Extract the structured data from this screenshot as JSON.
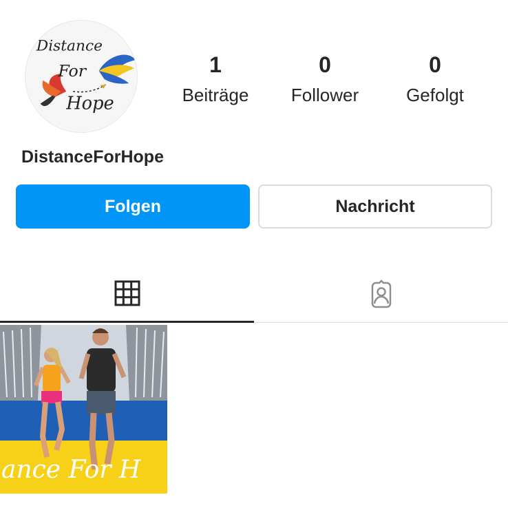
{
  "profile": {
    "username": "DistanceForHope",
    "avatar_alt": "DistanceForHope logo",
    "logo_text": "Distance For Hope",
    "stats": [
      {
        "value": "1",
        "label": "Beiträge"
      },
      {
        "value": "0",
        "label": "Follower"
      },
      {
        "value": "0",
        "label": "Gefolgt"
      }
    ]
  },
  "actions": {
    "follow_label": "Folgen",
    "message_label": "Nachricht"
  },
  "tabs": [
    {
      "name": "posts-grid",
      "icon": "grid-icon",
      "active": true
    },
    {
      "name": "tagged",
      "icon": "tagged-person-icon",
      "active": false
    }
  ],
  "posts": [
    {
      "caption_overlay": "ance For H"
    }
  ],
  "colors": {
    "accent": "#0095f6",
    "text": "#262626",
    "flag_blue": "#1f5fb5",
    "flag_yellow": "#f7d117"
  }
}
